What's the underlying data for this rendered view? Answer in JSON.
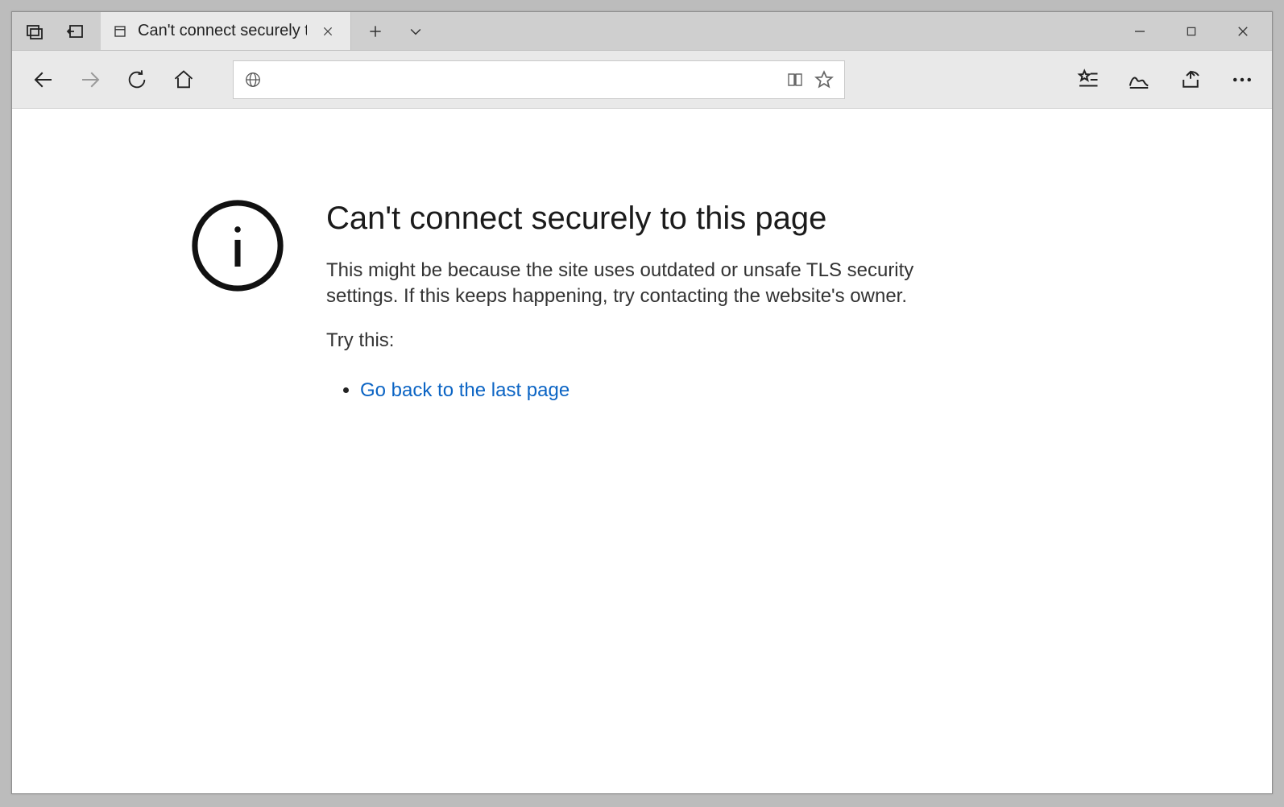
{
  "tab": {
    "title": "Can't connect securely t"
  },
  "addressbar": {
    "value": "",
    "placeholder": ""
  },
  "error": {
    "heading": "Can't connect securely to this page",
    "description": "This might be because the site uses outdated or unsafe TLS security settings. If this keeps happening, try contacting the website's owner.",
    "try_label": "Try this:",
    "go_back_link": "Go back to the last page"
  }
}
